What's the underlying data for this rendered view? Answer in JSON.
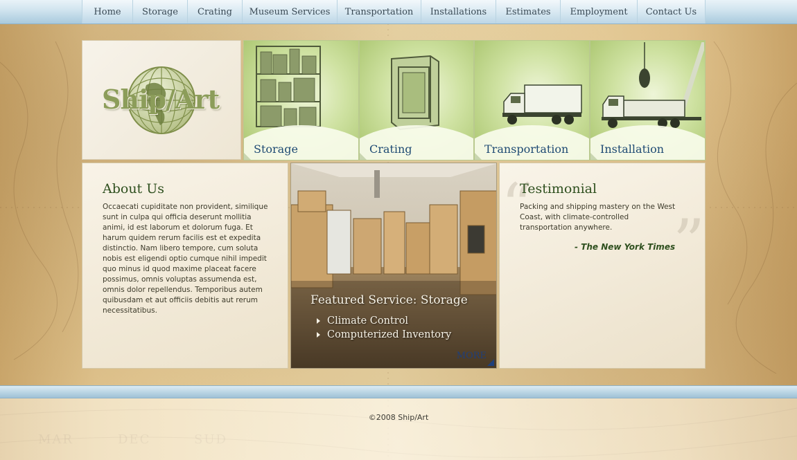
{
  "nav": {
    "items": [
      {
        "label": "Home",
        "width": 73
      },
      {
        "label": "Storage",
        "width": 79
      },
      {
        "label": "Crating",
        "width": 79
      },
      {
        "label": "Museum Services",
        "width": 137
      },
      {
        "label": "Transportation",
        "width": 121
      },
      {
        "label": "Installations",
        "width": 108
      },
      {
        "label": "Estimates",
        "width": 93
      },
      {
        "label": "Employment",
        "width": 111
      },
      {
        "label": "Contact Us",
        "width": 99
      }
    ]
  },
  "logo": {
    "text": "Ship/Art"
  },
  "tiles": [
    {
      "label": "Storage",
      "icon": "shelving-icon"
    },
    {
      "label": "Crating",
      "icon": "crate-icon"
    },
    {
      "label": "Transportation",
      "icon": "truck-icon"
    },
    {
      "label": "Installation",
      "icon": "crane-truck-icon"
    }
  ],
  "about": {
    "title": "About Us",
    "body": "Occaecati cupiditate non provident, similique sunt in culpa qui officia deserunt mollitia animi, id est laborum et dolorum fuga. Et harum quidem rerum facilis est et expedita distinctio. Nam libero tempore, cum soluta nobis est eligendi optio cumque nihil impedit quo minus id quod maxime placeat facere possimus, omnis voluptas assumenda est, omnis dolor repellendus. Temporibus autem quibusdam et aut officiis debitis aut rerum necessitatibus."
  },
  "featured": {
    "title": "Featured Service:  Storage",
    "items": [
      "Climate Control",
      "Computerized Inventory"
    ],
    "more": "MORE"
  },
  "testimonial": {
    "title": "Testimonial",
    "quote": "Packing and shipping mastery on the West Coast, with climate-controlled transportation anywhere.",
    "source": "- The New York Times"
  },
  "footer": {
    "copyright": "©2008 Ship/Art"
  },
  "colors": {
    "nav_blue": "#cfe3ee",
    "tile_green": "#cfe2a2",
    "heading_green": "#2e4f1e",
    "tile_label_blue": "#1e4a73",
    "parchment": "#e8d3a3"
  }
}
